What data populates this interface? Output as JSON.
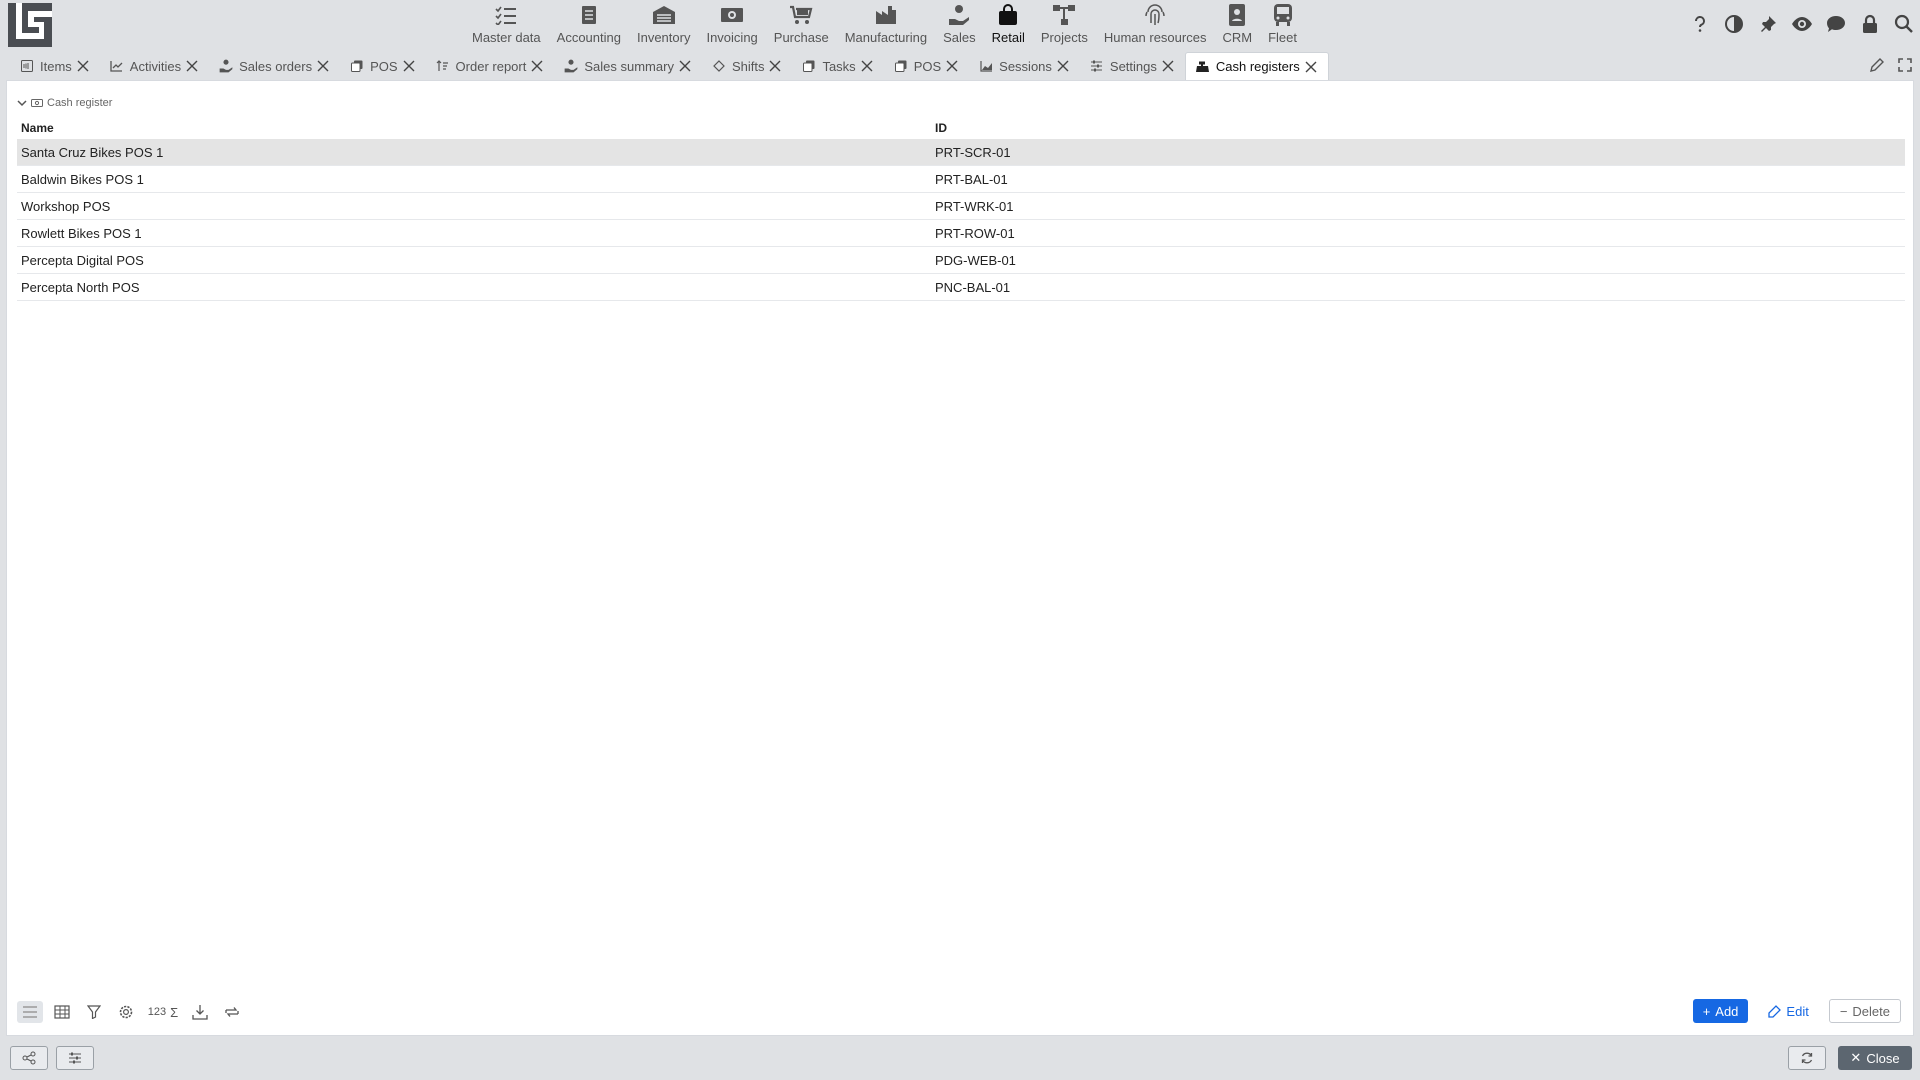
{
  "app": {
    "logo": "app-logo"
  },
  "modules": [
    {
      "label": "Master data",
      "icon": "checklist-icon",
      "active": false
    },
    {
      "label": "Accounting",
      "icon": "ledger-icon",
      "active": false
    },
    {
      "label": "Inventory",
      "icon": "warehouse-icon",
      "active": false
    },
    {
      "label": "Invoicing",
      "icon": "banknote-icon",
      "active": false
    },
    {
      "label": "Purchase",
      "icon": "cart-icon",
      "active": false
    },
    {
      "label": "Manufacturing",
      "icon": "factory-icon",
      "active": false
    },
    {
      "label": "Sales",
      "icon": "hand-coin-icon",
      "active": false
    },
    {
      "label": "Retail",
      "icon": "shopping-bag-icon",
      "active": true
    },
    {
      "label": "Projects",
      "icon": "diagram-icon",
      "active": false
    },
    {
      "label": "Human resources",
      "icon": "fingerprint-icon",
      "active": false
    },
    {
      "label": "CRM",
      "icon": "contact-book-icon",
      "active": false
    },
    {
      "label": "Fleet",
      "icon": "bus-icon",
      "active": false
    }
  ],
  "top_actions": [
    "help-icon",
    "contrast-icon",
    "pin-icon",
    "eye-icon",
    "chat-icon",
    "lock-icon",
    "search-icon"
  ],
  "tabs": [
    {
      "label": "Items",
      "icon": "nfc-icon",
      "active": false
    },
    {
      "label": "Activities",
      "icon": "line-chart-icon",
      "active": false
    },
    {
      "label": "Sales orders",
      "icon": "hand-coin-icon",
      "active": false
    },
    {
      "label": "POS",
      "icon": "copy-icon",
      "active": false
    },
    {
      "label": "Order report",
      "icon": "sort-icon",
      "active": false
    },
    {
      "label": "Sales summary",
      "icon": "hand-coin-icon",
      "active": false
    },
    {
      "label": "Shifts",
      "icon": "diamond-icon",
      "active": false
    },
    {
      "label": "Tasks",
      "icon": "copy-icon",
      "active": false
    },
    {
      "label": "POS",
      "icon": "copy-icon",
      "active": false
    },
    {
      "label": "Sessions",
      "icon": "area-chart-icon",
      "active": false
    },
    {
      "label": "Settings",
      "icon": "sliders-icon",
      "active": false
    },
    {
      "label": "Cash registers",
      "icon": "cash-register-icon",
      "active": true
    }
  ],
  "section": {
    "title": "Cash register"
  },
  "grid": {
    "columns": [
      "Name",
      "ID"
    ],
    "rows": [
      {
        "name": "Santa Cruz Bikes POS 1",
        "id": "PRT-SCR-01",
        "selected": true
      },
      {
        "name": "Baldwin Bikes POS 1",
        "id": "PRT-BAL-01",
        "selected": false
      },
      {
        "name": "Workshop POS",
        "id": "PRT-WRK-01",
        "selected": false
      },
      {
        "name": "Rowlett Bikes POS 1",
        "id": "PRT-ROW-01",
        "selected": false
      },
      {
        "name": "Percepta Digital POS",
        "id": "PDG-WEB-01",
        "selected": false
      },
      {
        "name": "Percepta North POS",
        "id": "PNC-BAL-01",
        "selected": false
      }
    ]
  },
  "toolbar": {
    "count_label": "123",
    "sum_label": "Σ",
    "add_label": "Add",
    "edit_label": "Edit",
    "delete_label": "Delete"
  },
  "footer": {
    "close_label": "Close"
  },
  "colors": {
    "accent": "#1668e3",
    "background": "#dfe1e4",
    "selected_row": "#e4e4e4",
    "close_button": "#5c6670"
  }
}
